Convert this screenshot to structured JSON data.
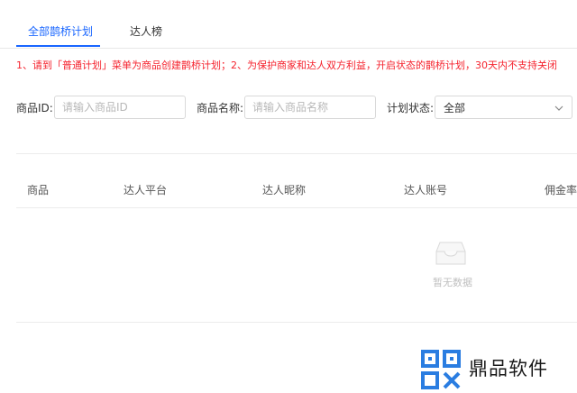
{
  "tabs": [
    {
      "label": "全部鹊桥计划",
      "active": true
    },
    {
      "label": "达人榜",
      "active": false
    }
  ],
  "notice": "1、请到「普通计划」菜单为商品创建鹊桥计划；2、为保护商家和达人双方利益，开启状态的鹊桥计划，30天内不支持关闭",
  "filters": {
    "product_id": {
      "label": "商品ID:",
      "placeholder": "请输入商品ID",
      "value": ""
    },
    "product_name": {
      "label": "商品名称:",
      "placeholder": "请输入商品名称",
      "value": ""
    },
    "plan_status": {
      "label": "计划状态:",
      "selected": "全部"
    }
  },
  "table": {
    "columns": [
      "商品",
      "达人平台",
      "达人昵称",
      "达人账号",
      "佣金率"
    ],
    "rows": [],
    "empty_text": "暂无数据"
  },
  "watermark": {
    "text": "鼎品软件"
  },
  "colors": {
    "accent": "#1966ff",
    "notice": "#f5222d",
    "watermark": "#2a7de1"
  }
}
